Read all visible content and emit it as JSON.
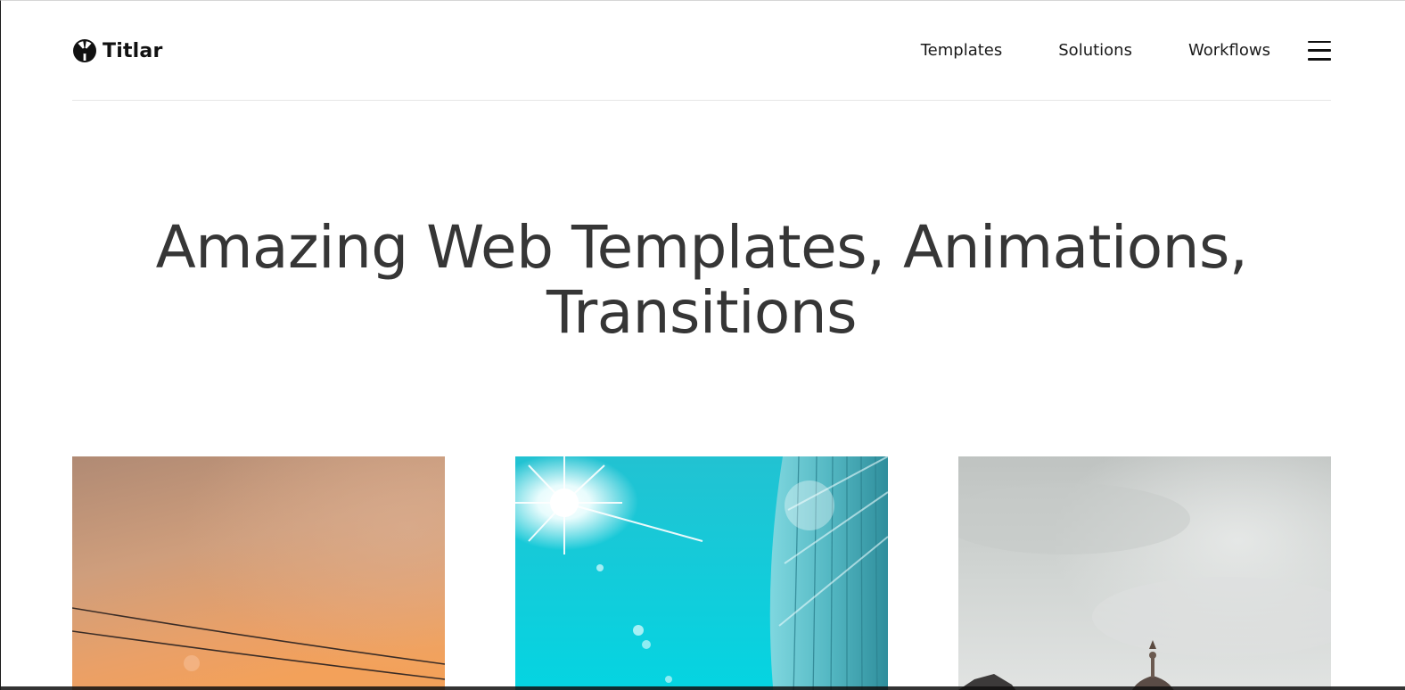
{
  "brand": {
    "name": "Titlar",
    "logo_icon": "titlar-logo-icon"
  },
  "nav": {
    "items": [
      {
        "label": "Templates"
      },
      {
        "label": "Solutions"
      },
      {
        "label": "Workflows"
      }
    ],
    "menu_icon": "hamburger-menu-icon"
  },
  "hero": {
    "title_line1": "Amazing Web Templates, Animations,",
    "title_line2": "Transitions"
  },
  "cards": [
    {
      "image": "orange-sunset-sky-with-power-lines",
      "accent": "#e9a062"
    },
    {
      "image": "bright-sun-over-glass-building",
      "accent": "#19c9d6"
    },
    {
      "image": "cloudy-grey-sky-over-dome-rooftop",
      "accent": "#c8cbc9"
    }
  ],
  "colors": {
    "text": "#363636",
    "nav_text": "#1a1a1a",
    "divider": "#e6e6e6",
    "background": "#ffffff"
  }
}
